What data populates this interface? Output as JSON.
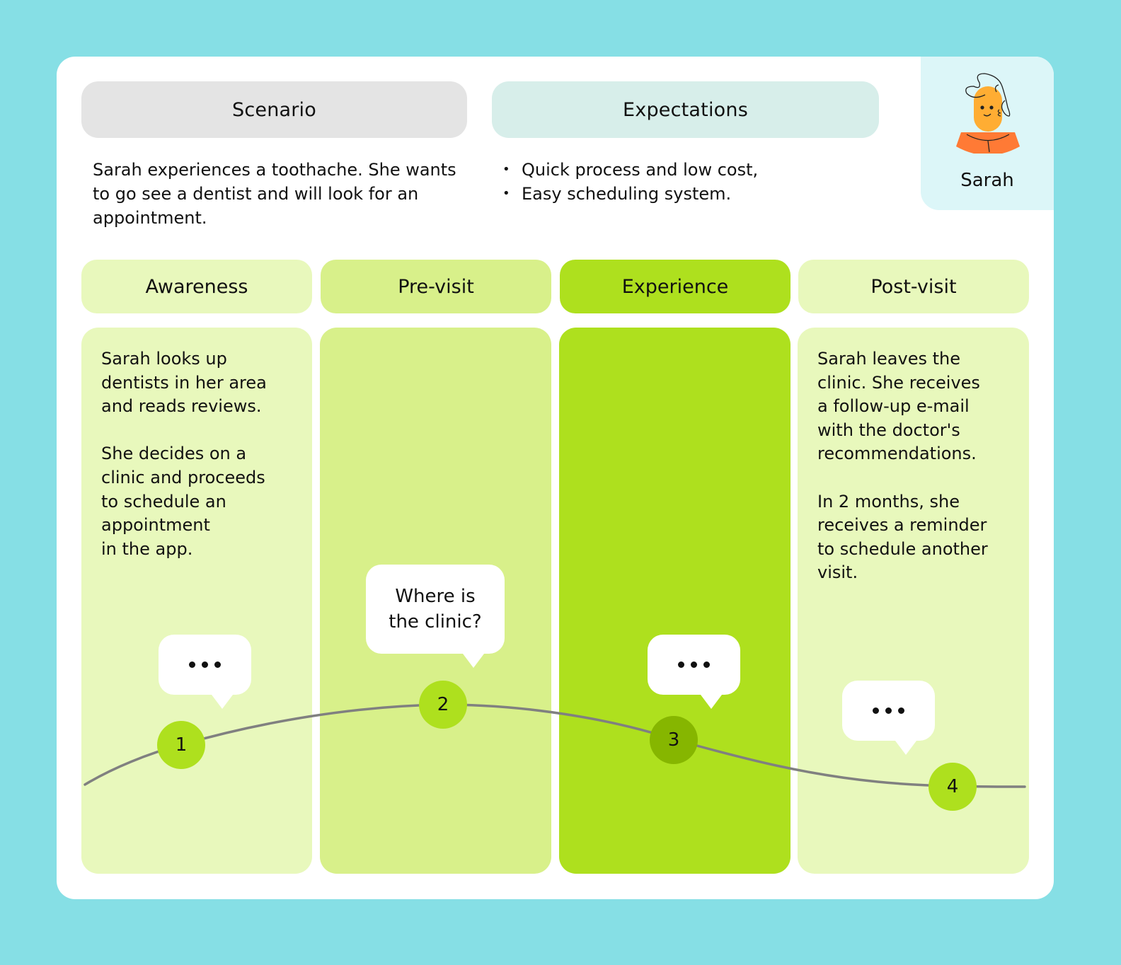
{
  "scenario": {
    "title": "Scenario",
    "text": "Sarah experiences a toothache. She wants to go see a dentist and will look for an appointment."
  },
  "expectations": {
    "title": "Expectations",
    "items": [
      "Quick process and low cost,",
      "Easy scheduling system."
    ]
  },
  "persona": {
    "name": "Sarah",
    "avatar_icon": "person-avatar-icon"
  },
  "stages": [
    {
      "label": "Awareness",
      "text": "Sarah looks up\ndentists in her area\nand reads reviews.\n\nShe decides on a\nclinic and proceeds\nto schedule an\nappointment\nin the app.",
      "color": "#e8f8bc"
    },
    {
      "label": "Pre-visit",
      "text": "",
      "color": "#d8f08a"
    },
    {
      "label": "Experience",
      "text": "",
      "color": "#aee01e"
    },
    {
      "label": "Post-visit",
      "text": "Sarah leaves the\nclinic. She receives\na follow-up e-mail\nwith the doctor's\nrecommendations.\n\nIn 2 months, she\nreceives a reminder\nto schedule another\nvisit.",
      "color": "#e8f8bc"
    }
  ],
  "touchpoints": [
    {
      "number": "1",
      "bubble": "…"
    },
    {
      "number": "2",
      "bubble": "Where is the clinic?"
    },
    {
      "number": "3",
      "bubble": "…"
    },
    {
      "number": "4",
      "bubble": "…"
    }
  ],
  "colors": {
    "background": "#86dfe5",
    "accent": "#aee01e",
    "accent_dark": "#86b600",
    "journey_line": "#808080"
  }
}
